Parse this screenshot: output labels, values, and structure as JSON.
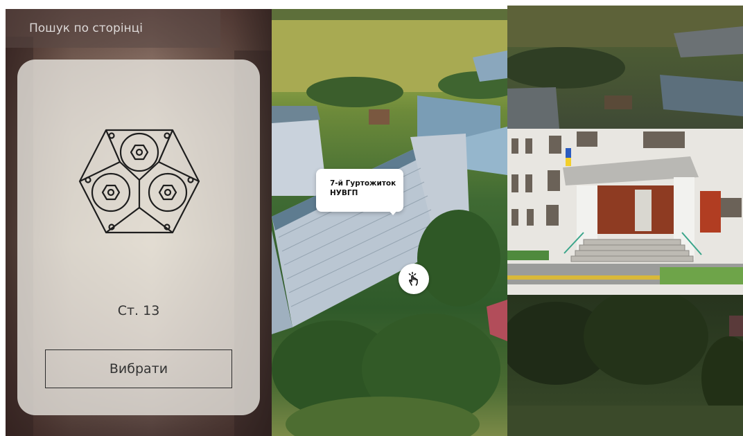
{
  "search": {
    "placeholder": "Пошук по сторінці"
  },
  "card": {
    "logo_icon": "hexagon-nut-logo-icon",
    "page_label": "Ст. 13",
    "select_label": "Вибрати"
  },
  "map": {
    "tooltip_line1": "7-й Гуртожиток",
    "tooltip_line2": "НУВГП",
    "hand_icon": "tap-hand-icon"
  },
  "colors": {
    "card_background": "#e9e6e0",
    "button_border": "#2a2a2a",
    "tooltip_background": "#ffffff"
  }
}
